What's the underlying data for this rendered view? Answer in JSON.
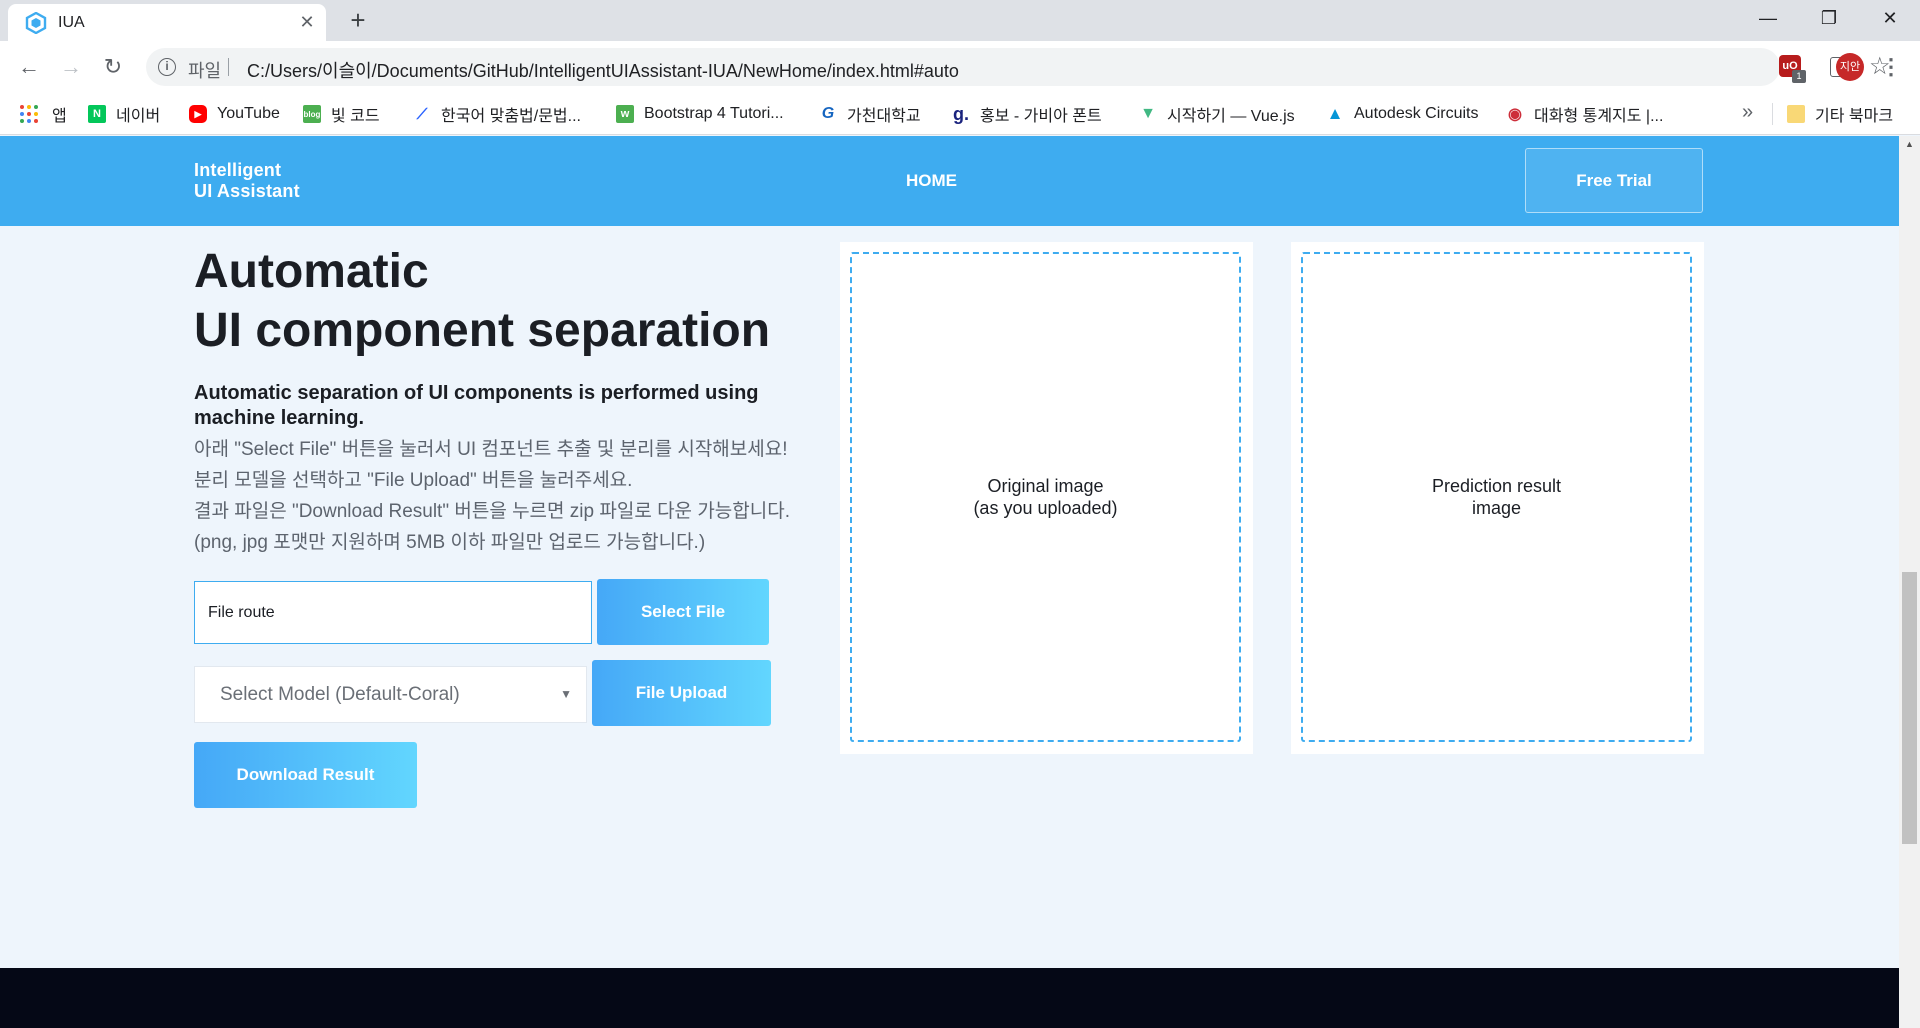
{
  "browser": {
    "tab_title": "IUA",
    "scheme_label": "파일",
    "url": "C:/Users/이슬이/Documents/GitHub/IntelligentUIAssistant-IUA/NewHome/index.html#auto",
    "extension_badge": "1",
    "profile_initials": "지안",
    "bookmarks": [
      {
        "label": "앱",
        "icon": "apps-grid-icon"
      },
      {
        "label": "네이버",
        "icon": "naver-icon",
        "color": "#03c75a",
        "glyph": "N"
      },
      {
        "label": "YouTube",
        "icon": "youtube-icon",
        "color": "#ff0000",
        "glyph": "▶"
      },
      {
        "label": "빛 코드",
        "icon": "blog-icon",
        "color": "#4caf50",
        "glyph": "b"
      },
      {
        "label": "한국어 맞춤법/문법...",
        "icon": "spellcheck-icon",
        "color": "#2962ff",
        "glyph": "✓"
      },
      {
        "label": "Bootstrap 4 Tutori...",
        "icon": "w3schools-icon",
        "color": "#4caf50",
        "glyph": "w"
      },
      {
        "label": "가천대학교",
        "icon": "gachon-icon",
        "color": "#1565c0",
        "glyph": "G"
      },
      {
        "label": "홍보 - 가비아 폰트",
        "icon": "gabia-icon",
        "color": "#1a237e",
        "glyph": "g"
      },
      {
        "label": "시작하기 — Vue.js",
        "icon": "vue-icon",
        "color": "#41b883",
        "glyph": "V"
      },
      {
        "label": "Autodesk Circuits",
        "icon": "autodesk-icon",
        "color": "#0696d7",
        "glyph": "A"
      },
      {
        "label": "대화형 통계지도 |...",
        "icon": "stats-map-icon",
        "color": "#cd2e3a",
        "glyph": "●"
      }
    ],
    "more_bookmarks": "»",
    "other_bookmarks": "기타 북마크"
  },
  "site": {
    "logo_line1": "Intelligent",
    "logo_line2": "UI Assistant",
    "nav_home": "HOME",
    "free_trial": "Free Trial"
  },
  "hero": {
    "title_line1": "Automatic",
    "title_line2": "UI component separation",
    "subtitle": "Automatic separation of UI components is performed using machine learning.",
    "desc_lines": [
      "아래 \"Select File\" 버튼을 눌러서 UI 컴포넌트 추출 및 분리를 시작해보세요!",
      "분리 모델을 선택하고 \"File Upload\" 버튼을 눌러주세요.",
      "결과 파일은 \"Download Result\" 버튼을 누르면 zip 파일로 다운 가능합니다.",
      "(png, jpg 포맷만 지원하며 5MB 이하 파일만 업로드 가능합니다.)"
    ]
  },
  "form": {
    "file_route": "File route",
    "select_file": "Select File",
    "model_select": "Select Model (Default-Coral)",
    "file_upload": "File Upload",
    "download_result": "Download Result"
  },
  "panels": {
    "original_line1": "Original image",
    "original_line2": "(as you uploaded)",
    "prediction_line1": "Prediction result",
    "prediction_line2": "image"
  },
  "colors": {
    "brand_blue": "#3eacf0",
    "gradient_start": "#45a8f7",
    "gradient_end": "#62d6fe",
    "page_bg": "#eef5fc",
    "footer_bg": "#050816"
  }
}
